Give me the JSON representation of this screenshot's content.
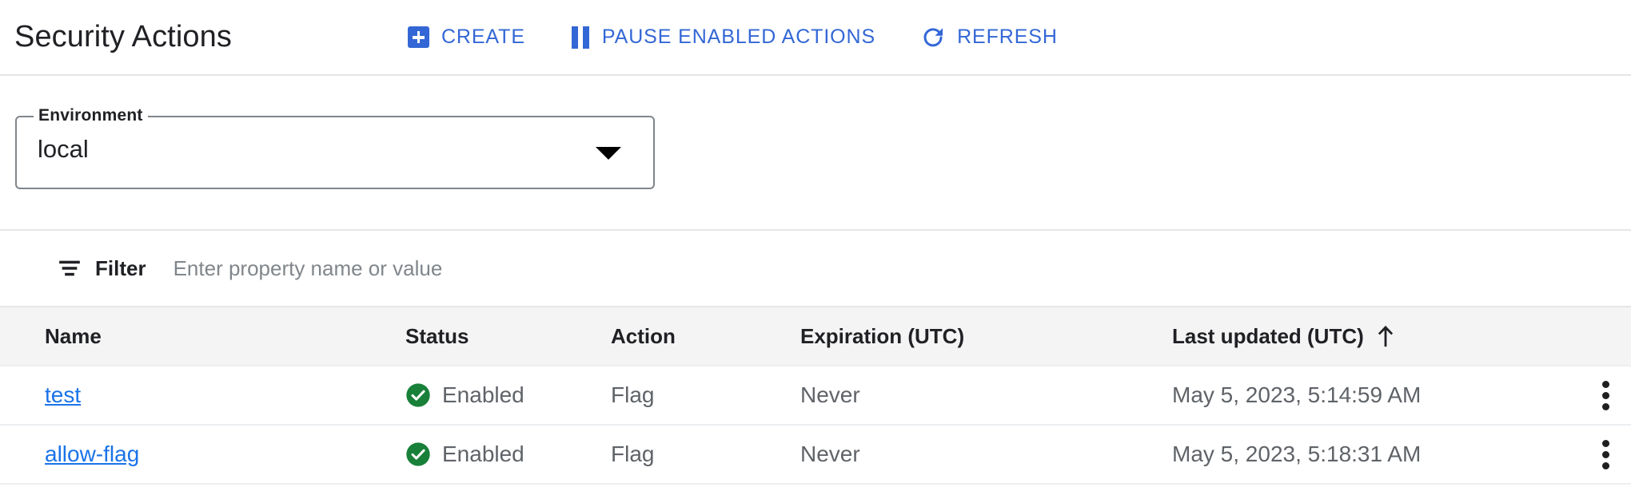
{
  "header": {
    "title": "Security Actions",
    "toolbar": [
      {
        "id": "create",
        "label": "CREATE",
        "icon": "plus-box-icon"
      },
      {
        "id": "pause-enabled-actions",
        "label": "PAUSE ENABLED ACTIONS",
        "icon": "pause-icon"
      },
      {
        "id": "refresh",
        "label": "REFRESH",
        "icon": "refresh-icon"
      }
    ],
    "accent_color": "#3367d6"
  },
  "environment": {
    "label": "Environment",
    "value": "local",
    "dropdown_icon": "chevron-down-icon"
  },
  "filter": {
    "icon": "filter-icon",
    "label": "Filter",
    "value": "",
    "placeholder": "Enter property name or value"
  },
  "table": {
    "columns": [
      {
        "key": "name",
        "label": "Name"
      },
      {
        "key": "status",
        "label": "Status"
      },
      {
        "key": "action",
        "label": "Action"
      },
      {
        "key": "expiration",
        "label": "Expiration (UTC)"
      },
      {
        "key": "last_updated",
        "label": "Last updated (UTC)",
        "sort": "ascending",
        "sort_icon": "arrow-up-icon"
      },
      {
        "key": "menu",
        "label": ""
      }
    ],
    "rows": [
      {
        "name": "test",
        "status": "Enabled",
        "status_icon": "check-circle-icon",
        "status_color": "#188038",
        "action": "Flag",
        "expiration": "Never",
        "last_updated": "May 5, 2023, 5:14:59 AM",
        "menu_icon": "more-vert-icon"
      },
      {
        "name": "allow-flag",
        "status": "Enabled",
        "status_icon": "check-circle-icon",
        "status_color": "#188038",
        "action": "Flag",
        "expiration": "Never",
        "last_updated": "May 5, 2023, 5:18:31 AM",
        "menu_icon": "more-vert-icon"
      }
    ]
  },
  "colors": {
    "link": "#1a73e8",
    "accent": "#3367d6",
    "success": "#188038",
    "header_bg": "#f4f4f4",
    "divider": "#e4e6e8"
  }
}
